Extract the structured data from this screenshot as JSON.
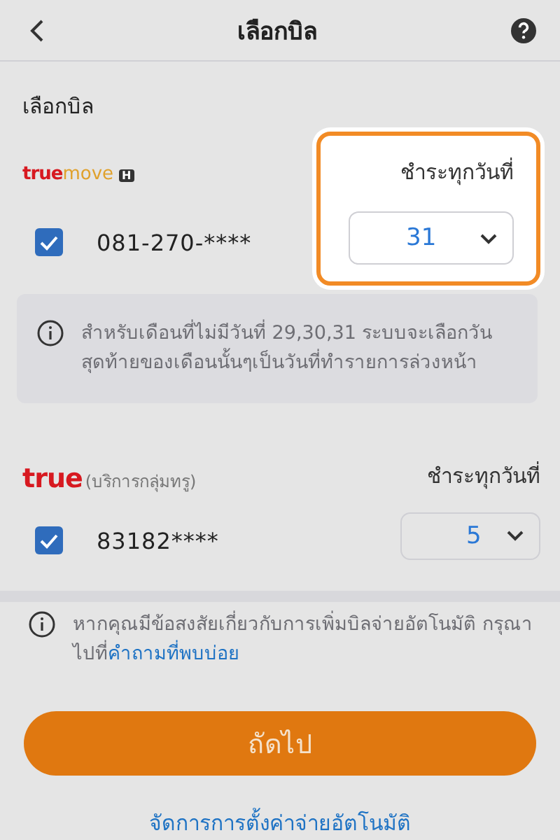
{
  "header": {
    "title": "เลือกบิล"
  },
  "section_title": "เลือกบิล",
  "bills": [
    {
      "brand": "true",
      "brand_suffix": "move",
      "brand_badge": "H",
      "pay_label": "ชำระทุกวันที่",
      "number": "081-270-****",
      "checked": true,
      "day": "31",
      "highlighted": true,
      "note": "สำหรับเดือนที่ไม่มีวันที่ 29,30,31 ระบบจะเลือกวันสุดท้ายของเดือนนั้นๆเป็นวันที่ทำรายการล่วงหน้า"
    },
    {
      "brand": "true",
      "brand_note": "(บริการกลุ่มทรู)",
      "pay_label": "ชำระทุกวันที่",
      "number": "83182****",
      "checked": true,
      "day": "5",
      "highlighted": false
    }
  ],
  "footer_note": {
    "text": "หากคุณมีข้อสงสัยเกี่ยวกับการเพิ่มบิลจ่ายอัตโนมัติ กรุณาไปที่",
    "link": "คำถามที่พบบ่อย"
  },
  "next_button": "ถัดไป",
  "manage_link": "จัดการการตั้งค่าจ่ายอัตโนมัติ"
}
